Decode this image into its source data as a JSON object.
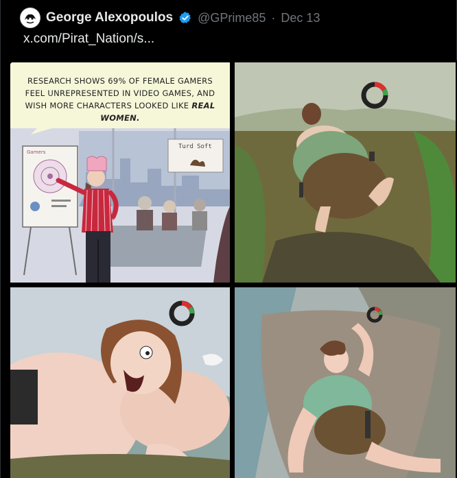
{
  "tweet": {
    "author_name": "George Alexopoulos",
    "handle": "@GPrime85",
    "separator": "·",
    "date": "Dec 13",
    "link_text": "x.com/Pirat_Nation/s..."
  },
  "comic": {
    "caption_part1": "RESEARCH SHOWS 69% OF FEMALE GAMERS FEEL UNREPRESENTED IN VIDEO GAMES, AND WISH MORE CHARACTERS LOOKED LIKE ",
    "caption_emph": "REAL WOMEN.",
    "chart_title": "Gamers",
    "sign_text": "Turd Soft"
  },
  "colors": {
    "background": "#000000",
    "name": "#e7e9ea",
    "muted": "#71767b",
    "verified": "#1d9bf0",
    "caption_bg": "#f6f7d9"
  }
}
